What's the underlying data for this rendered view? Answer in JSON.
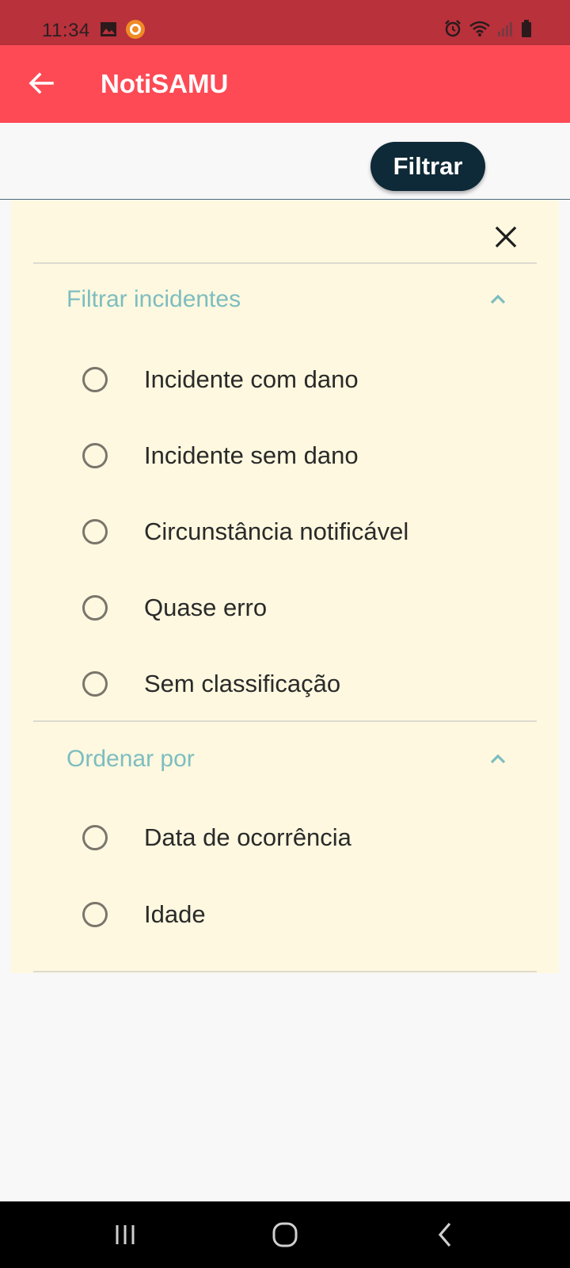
{
  "status_bar": {
    "time": "11:34",
    "left_icons": [
      "image-icon",
      "screen-recorder-icon"
    ],
    "right_icons": [
      "alarm-icon",
      "wifi-icon",
      "signal-icon",
      "battery-icon"
    ]
  },
  "app_bar": {
    "title": "NotiSAMU",
    "back_icon": "arrow-back-icon"
  },
  "toolbar": {
    "filter_label": "Filtrar"
  },
  "filter_panel": {
    "close_icon": "close-icon",
    "sections": [
      {
        "title": "Filtrar incidentes",
        "expanded": true,
        "options": [
          "Incidente com dano",
          "Incidente sem dano",
          "Circunstância notificável",
          "Quase erro",
          "Sem classificação"
        ]
      },
      {
        "title": "Ordenar por",
        "expanded": true,
        "options": [
          "Data de ocorrência",
          "Idade"
        ]
      }
    ]
  },
  "nav_bar": {
    "buttons": [
      "recent-apps-icon",
      "home-icon",
      "back-nav-icon"
    ]
  },
  "colors": {
    "status_bar": "#b8313b",
    "app_bar": "#fe4a55",
    "filter_button": "#0e2937",
    "panel_background": "#fdf8df",
    "section_title": "#7dbdc1"
  }
}
